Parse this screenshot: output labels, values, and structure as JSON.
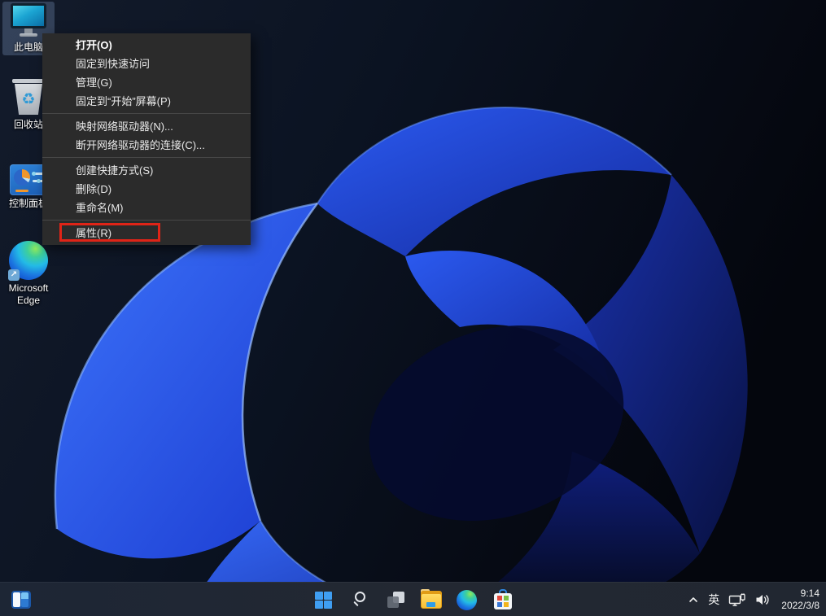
{
  "desktop": {
    "icons": [
      {
        "name": "this-pc",
        "label": "此电脑",
        "selected": true
      },
      {
        "name": "recycle-bin",
        "label": "回收站",
        "selected": false
      },
      {
        "name": "control-panel",
        "label": "控制面板",
        "selected": false
      },
      {
        "name": "microsoft-edge",
        "label": "Microsoft Edge",
        "selected": false
      }
    ]
  },
  "context_menu": {
    "items": {
      "open": "打开(O)",
      "pin_quick_access": "固定到快速访问",
      "manage": "管理(G)",
      "pin_start": "固定到“开始”屏幕(P)",
      "map_network_drive": "映射网络驱动器(N)...",
      "disconnect_network_drive": "断开网络驱动器的连接(C)...",
      "create_shortcut": "创建快捷方式(S)",
      "delete": "删除(D)",
      "rename": "重命名(M)",
      "properties": "属性(R)"
    },
    "annotation": {
      "highlighted_item": "属性(R)",
      "box_color": "#e02417"
    },
    "colors": {
      "menu_background": "#2b2b2b",
      "separator": "#474747",
      "text": "#e9e9e9"
    }
  },
  "taskbar": {
    "colors": {
      "background": "#212731"
    },
    "buttons": [
      {
        "name": "widgets"
      },
      {
        "name": "start"
      },
      {
        "name": "search"
      },
      {
        "name": "task-view"
      },
      {
        "name": "file-explorer"
      },
      {
        "name": "edge"
      },
      {
        "name": "microsoft-store"
      }
    ],
    "tray": {
      "icons": [
        "chevron-up",
        "network",
        "volume"
      ],
      "ime": "英",
      "time": "9:14",
      "date": "2022/3/8"
    }
  },
  "wallpaper": {
    "colors": {
      "base_dark": "#0a1220",
      "petal_bright": "#2f63f2",
      "petal_dark": "#0a1560",
      "highlight": "#86b0ff"
    }
  }
}
